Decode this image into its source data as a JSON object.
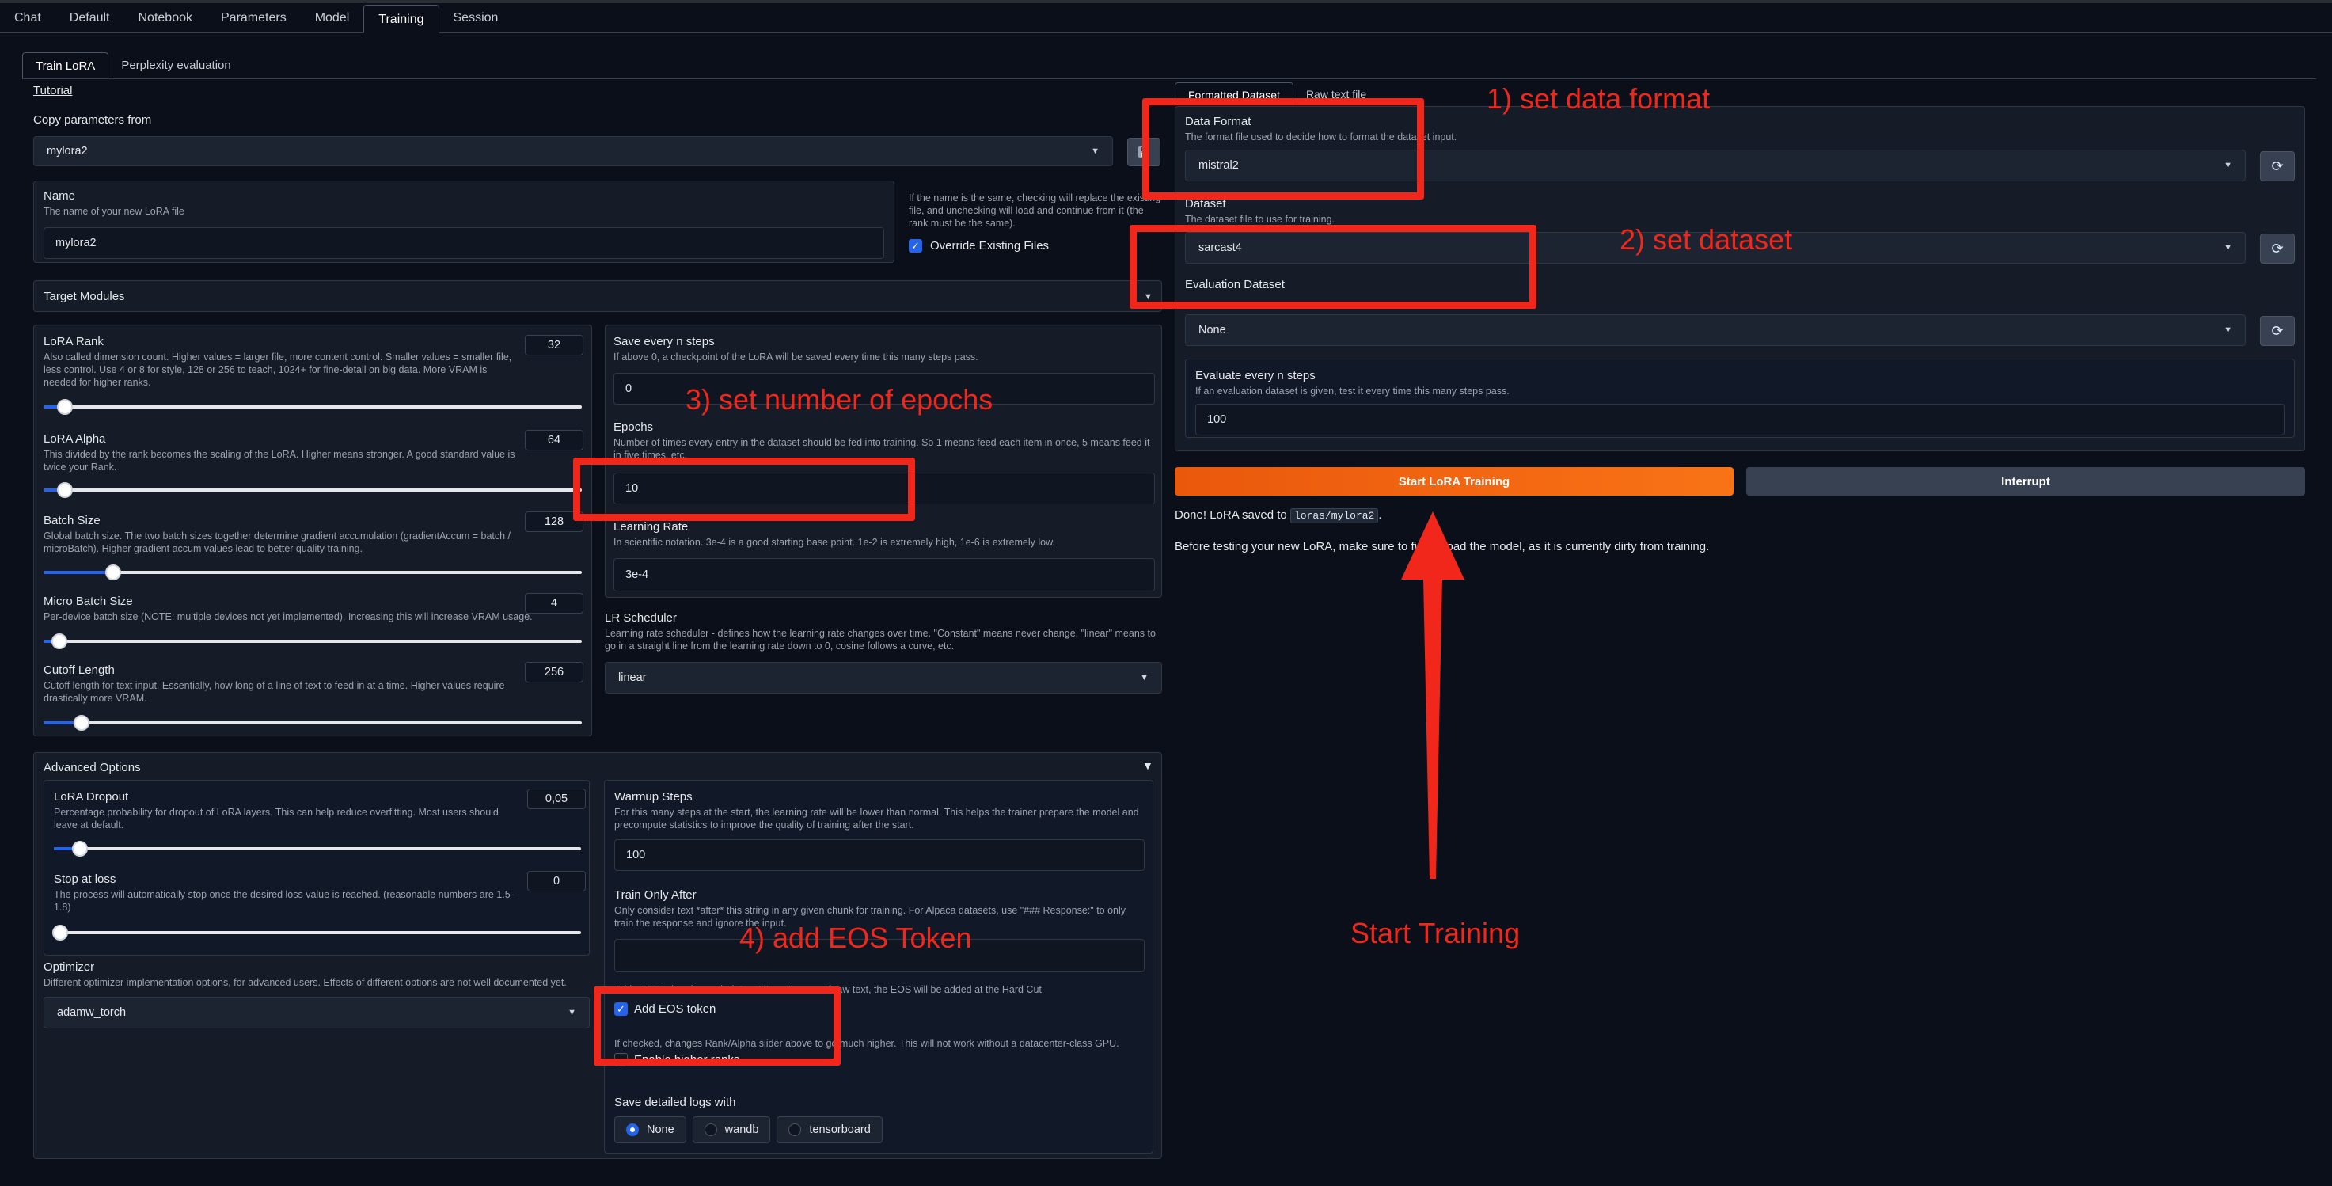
{
  "main_tabs": [
    "Chat",
    "Default",
    "Notebook",
    "Parameters",
    "Model",
    "Training",
    "Session"
  ],
  "sub_tabs": [
    "Train LoRA",
    "Perplexity evaluation"
  ],
  "tutorial_link": "Tutorial",
  "copy_params": {
    "label": "Copy parameters from",
    "value": "mylora2"
  },
  "name": {
    "label": "Name",
    "desc": "The name of your new LoRA file",
    "value": "mylora2"
  },
  "override": {
    "note": "If the name is the same, checking will replace the existing file, and unchecking will load and continue from it (the rank must be the same).",
    "label": "Override Existing Files",
    "checked": true
  },
  "target_modules": "Target Modules",
  "lora_rank": {
    "label": "LoRA Rank",
    "value": "32",
    "desc": "Also called dimension count. Higher values = larger file, more content control. Smaller values = smaller file, less control. Use 4 or 8 for style, 128 or 256 to teach, 1024+ for fine-detail on big data. More VRAM is needed for higher ranks.",
    "fill_fraction": 0.04
  },
  "lora_alpha": {
    "label": "LoRA Alpha",
    "value": "64",
    "desc": "This divided by the rank becomes the scaling of the LoRA. Higher means stronger. A good standard value is twice your Rank.",
    "fill_fraction": 0.04
  },
  "batch_size": {
    "label": "Batch Size",
    "value": "128",
    "desc": "Global batch size. The two batch sizes together determine gradient accumulation (gradientAccum = batch / microBatch). Higher gradient accum values lead to better quality training.",
    "fill_fraction": 0.13
  },
  "micro_batch": {
    "label": "Micro Batch Size",
    "value": "4",
    "desc": "Per-device batch size (NOTE: multiple devices not yet implemented). Increasing this will increase VRAM usage.",
    "fill_fraction": 0.03
  },
  "cutoff": {
    "label": "Cutoff Length",
    "value": "256",
    "desc": "Cutoff length for text input. Essentially, how long of a line of text to feed in at a time. Higher values require drastically more VRAM.",
    "fill_fraction": 0.07
  },
  "save_steps": {
    "label": "Save every n steps",
    "desc": "If above 0, a checkpoint of the LoRA will be saved every time this many steps pass.",
    "value": "0"
  },
  "epochs": {
    "label": "Epochs",
    "desc": "Number of times every entry in the dataset should be fed into training. So 1 means feed each item in once, 5 means feed it in five times, etc.",
    "value": "10"
  },
  "learning_rate": {
    "label": "Learning Rate",
    "desc": "In scientific notation. 3e-4 is a good starting base point. 1e-2 is extremely high, 1e-6 is extremely low.",
    "value": "3e-4"
  },
  "lr_scheduler": {
    "label": "LR Scheduler",
    "desc": "Learning rate scheduler - defines how the learning rate changes over time. \"Constant\" means never change, \"linear\" means to go in a straight line from the learning rate down to 0, cosine follows a curve, etc.",
    "value": "linear"
  },
  "advanced": {
    "label": "Advanced Options",
    "toggle": "▼"
  },
  "lora_dropout": {
    "label": "LoRA Dropout",
    "value": "0,05",
    "desc": "Percentage probability for dropout of LoRA layers. This can help reduce overfitting. Most users should leave at default.",
    "fill_fraction": 0.05
  },
  "stop_loss": {
    "label": "Stop at loss",
    "value": "0",
    "desc": "The process will automatically stop once the desired loss value is reached. (reasonable numbers are 1.5-1.8)",
    "fill_fraction": 0.0
  },
  "optimizer": {
    "label": "Optimizer",
    "desc": "Different optimizer implementation options, for advanced users. Effects of different options are not well documented yet.",
    "value": "adamw_torch"
  },
  "warmup": {
    "label": "Warmup Steps",
    "desc": "For this many steps at the start, the learning rate will be lower than normal. This helps the trainer prepare the model and precompute statistics to improve the quality of training after the start.",
    "value": "100"
  },
  "train_only_after": {
    "label": "Train Only After",
    "desc": "Only consider text *after* this string in any given chunk for training. For Alpaca datasets, use \"### Response:\" to only train the response and ignore the input.",
    "value": ""
  },
  "eos": {
    "note": "Adds EOS token for each dataset item. In case of raw text, the EOS will be added at the Hard Cut",
    "label": "Add EOS token",
    "checked": true
  },
  "higher_ranks": {
    "note": "If checked, changes Rank/Alpha slider above to go much higher. This will not work without a datacenter-class GPU.",
    "label": "Enable higher ranks",
    "checked": false
  },
  "logs": {
    "label": "Save detailed logs with",
    "options": [
      "None",
      "wandb",
      "tensorboard"
    ],
    "selected": "None"
  },
  "dataset_tabs": [
    "Formatted Dataset",
    "Raw text file"
  ],
  "data_format": {
    "label": "Data Format",
    "desc": "The format file used to decide how to format the dataset input.",
    "value": "mistral2"
  },
  "dataset": {
    "label": "Dataset",
    "desc": "The dataset file to use for training.",
    "value": "sarcast4"
  },
  "eval_dataset": {
    "label": "Evaluation Dataset",
    "value": "None"
  },
  "eval_steps": {
    "label": "Evaluate every n steps",
    "desc": "If an evaluation dataset is given, test it every time this many steps pass.",
    "value": "100"
  },
  "start_button": "Start LoRA Training",
  "interrupt_button": "Interrupt",
  "status": {
    "prefix": "Done! LoRA saved to ",
    "path": "loras/mylora2",
    "suffix": ".",
    "note": "Before testing your new LoRA, make sure to first reload the model, as it is currently dirty from training."
  },
  "annotations": {
    "a1": "1) set data format",
    "a2": "2) set dataset",
    "a3": "3) set number of epochs",
    "a4": "4) add EOS Token",
    "a5": "Start Training"
  },
  "colors": {
    "accent": "#2563eb",
    "primary_button": "#f97316",
    "annotation": "#f0271a"
  },
  "icons": {
    "refresh": "refresh-icon",
    "save": "save-icon",
    "chevron": "chevron-down-icon"
  }
}
